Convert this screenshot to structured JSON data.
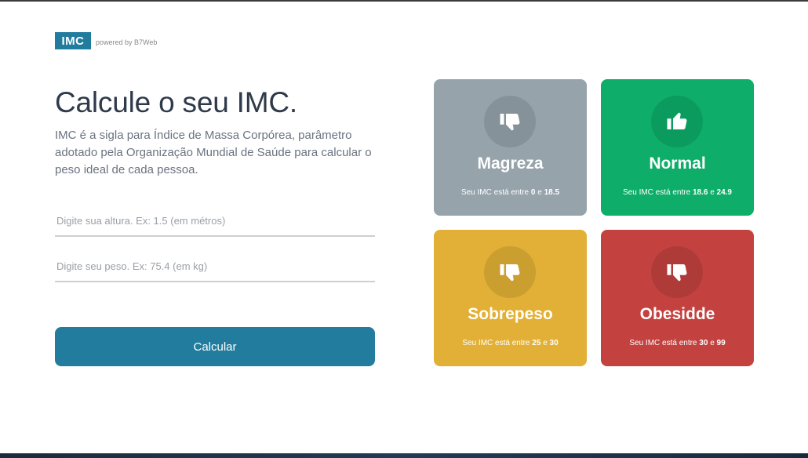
{
  "header": {
    "logo_text": "IMC",
    "powered_text": "powered by B7Web"
  },
  "main": {
    "title": "Calcule o seu IMC.",
    "description": "IMC é a sigla para Índice de Massa Corpórea, parâmetro adotado pela Organização Mundial de Saúde para calcular o peso ideal de cada pessoa.",
    "height_placeholder": "Digite sua altura. Ex: 1.5 (em métros)",
    "weight_placeholder": "Digite seu peso. Ex: 75.4 (em kg)",
    "calculate_label": "Calcular"
  },
  "levels": [
    {
      "title": "Magreza",
      "range_prefix": "Seu IMC está entre",
      "min": "0",
      "sep": "e",
      "max": "18.5",
      "color": "#96a3ab",
      "icon": "thumbs-down-icon"
    },
    {
      "title": "Normal",
      "range_prefix": "Seu IMC está entre",
      "min": "18.6",
      "sep": "e",
      "max": "24.9",
      "color": "#0ead69",
      "icon": "thumbs-up-icon"
    },
    {
      "title": "Sobrepeso",
      "range_prefix": "Seu IMC está entre",
      "min": "25",
      "sep": "e",
      "max": "30",
      "color": "#e2b036",
      "icon": "thumbs-down-icon"
    },
    {
      "title": "Obesidde",
      "range_prefix": "Seu IMC está entre",
      "min": "30",
      "sep": "e",
      "max": "99",
      "color": "#c3423f",
      "icon": "thumbs-down-icon"
    }
  ],
  "colors": {
    "accent": "#227c9d",
    "title": "#2e3a4a",
    "text": "#6a7380"
  }
}
